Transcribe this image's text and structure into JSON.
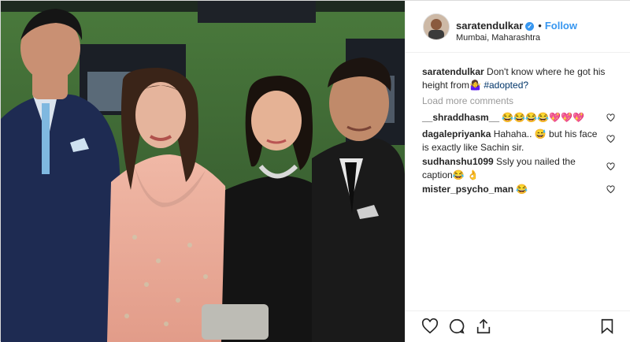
{
  "post": {
    "username": "saratendulkar",
    "follow_label": "Follow",
    "location": "Mumbai, Maharashtra",
    "caption_username": "saratendulkar",
    "caption_text": "Don't know where he got his height from🤷‍♀️ ",
    "caption_hashtag": "#adopted?",
    "load_more_label": "Load more comments"
  },
  "comments": [
    {
      "username": "__shraddhasm__",
      "text": "😂😂😂😂💖💖💖"
    },
    {
      "username": "dagalepriyanka",
      "text": "Hahaha.. 😅 but his face is exactly like Sachin sir."
    },
    {
      "username": "sudhanshu1099",
      "text": "Ssly you nailed the caption😂 👌"
    },
    {
      "username": "mister_psycho_man",
      "text": "😂"
    }
  ],
  "colors": {
    "accent": "#3897f0",
    "text": "#262626",
    "muted": "#999999",
    "hashtag": "#003569"
  },
  "icons": [
    "verified-badge-icon",
    "heart-icon",
    "comment-icon",
    "share-icon",
    "bookmark-icon"
  ]
}
